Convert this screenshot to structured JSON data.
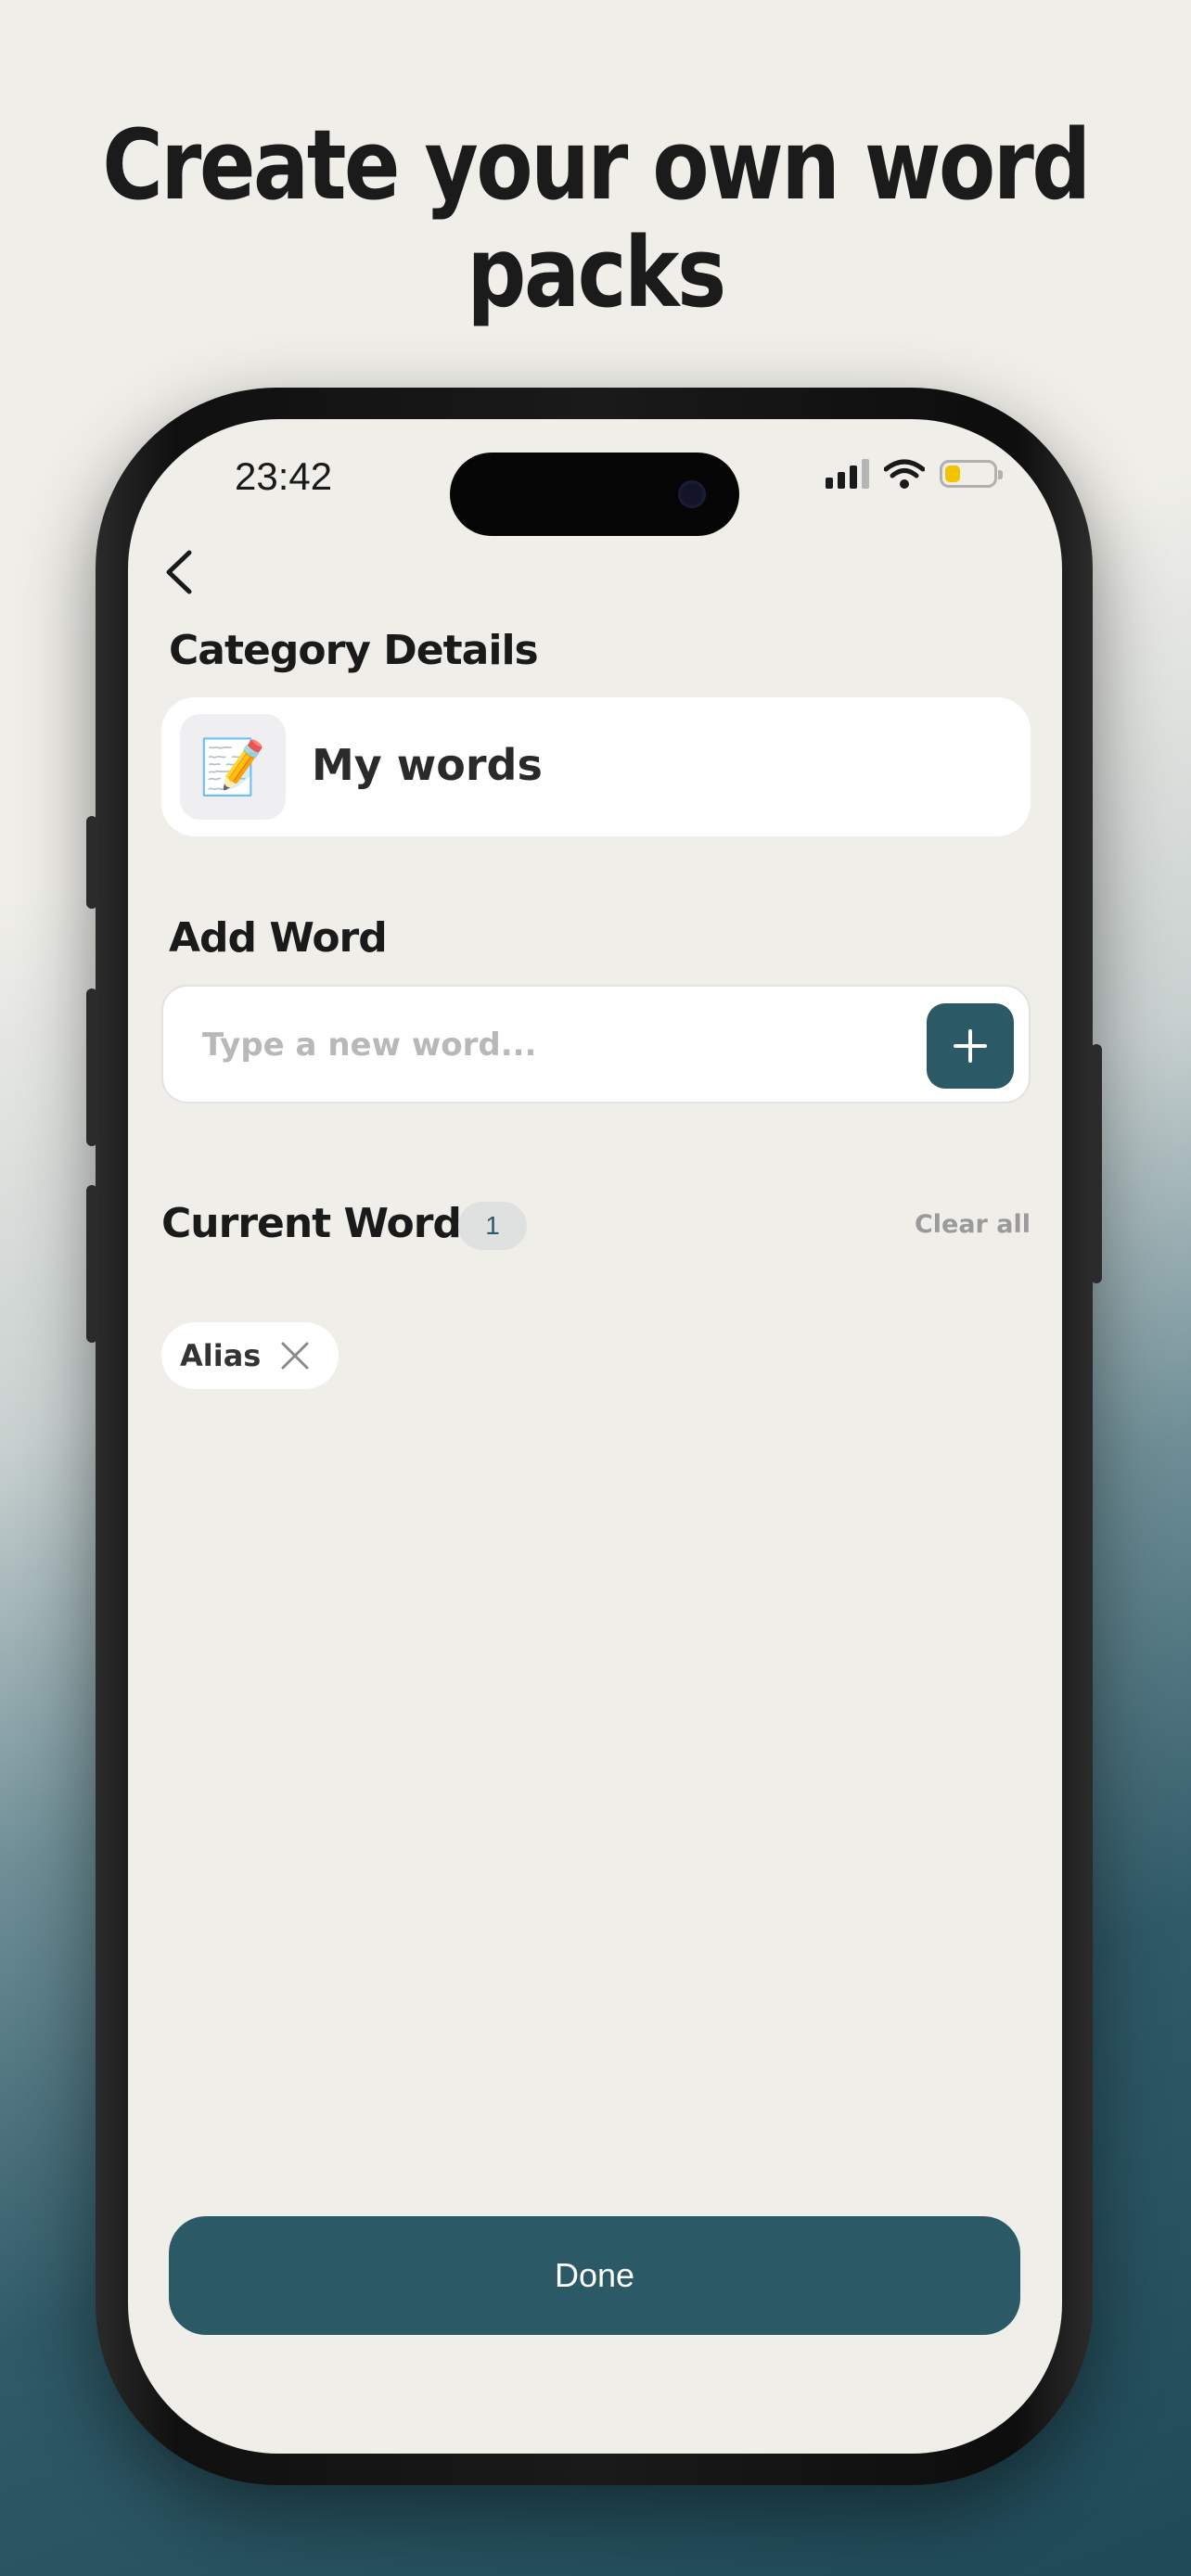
{
  "headline": "Create your own word packs",
  "status_bar": {
    "time": "23:42"
  },
  "category_details": {
    "title": "Category Details",
    "emoji": "📝",
    "name": "My words"
  },
  "add_word": {
    "title": "Add Word",
    "placeholder": "Type a new word..."
  },
  "current_words": {
    "title": "Current Words",
    "count": "1",
    "clear_label": "Clear all",
    "words": [
      "Alias"
    ]
  },
  "done_label": "Done",
  "colors": {
    "accent": "#2b5a66",
    "screen_background": "#efeee9",
    "battery_level": "#f2c400"
  }
}
